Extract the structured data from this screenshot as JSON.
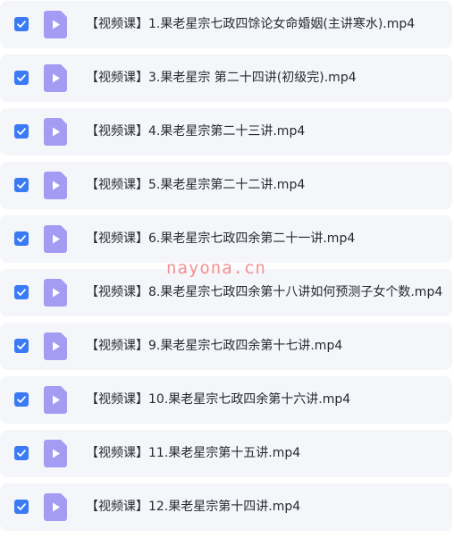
{
  "files": [
    {
      "name": "【视频课】1.果老星宗七政四馀论女命婚姻(主讲寒水).mp4",
      "checked": true,
      "icon": "video-file-icon"
    },
    {
      "name": "【视频课】3.果老星宗 第二十四讲(初级完).mp4",
      "checked": true,
      "icon": "video-file-icon"
    },
    {
      "name": "【视频课】4.果老星宗第二十三讲.mp4",
      "checked": true,
      "icon": "video-file-icon"
    },
    {
      "name": "【视频课】5.果老星宗第二十二讲.mp4",
      "checked": true,
      "icon": "video-file-icon"
    },
    {
      "name": "【视频课】6.果老星宗七政四余第二十一讲.mp4",
      "checked": true,
      "icon": "video-file-icon"
    },
    {
      "name": "【视频课】8.果老星宗七政四余第十八讲如何预测子女个数.mp4",
      "checked": true,
      "icon": "video-file-icon"
    },
    {
      "name": "【视频课】9.果老星宗七政四余第十七讲.mp4",
      "checked": true,
      "icon": "video-file-icon"
    },
    {
      "name": "【视频课】10.果老星宗七政四余第十六讲.mp4",
      "checked": true,
      "icon": "video-file-icon"
    },
    {
      "name": "【视频课】11.果老星宗第十五讲.mp4",
      "checked": true,
      "icon": "video-file-icon"
    },
    {
      "name": "【视频课】12.果老星宗第十四讲.mp4",
      "checked": true,
      "icon": "video-file-icon"
    }
  ],
  "watermark": "nayona.cn",
  "colors": {
    "row_background": "#f5f6fa",
    "checkbox": "#3a7af5",
    "file_icon": "#a49cf3",
    "text": "#252a33",
    "watermark": "#f06e6e"
  }
}
